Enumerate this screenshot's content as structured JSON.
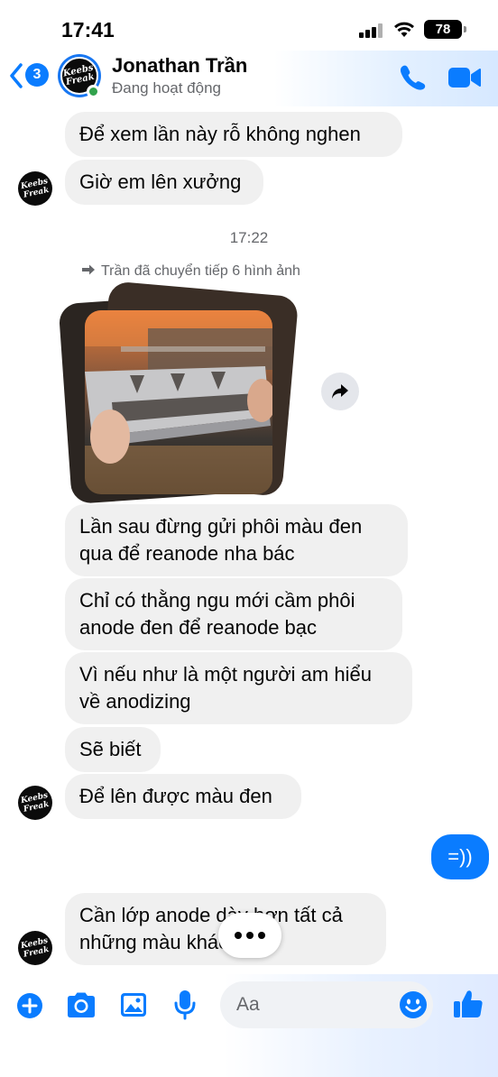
{
  "status_bar": {
    "time": "17:41",
    "battery": "78"
  },
  "header": {
    "back_badge": "3",
    "contact_name": "Jonathan Trần",
    "contact_status": "Đang hoạt động",
    "avatar_logo": [
      "Keebs",
      "Freak"
    ]
  },
  "conversation": {
    "bubbles_top": [
      {
        "text": "Để xem lần này rỗ không nghen"
      },
      {
        "text": "Giờ em lên xưởng"
      }
    ],
    "timestamp": "17:22",
    "forward_note": "Trần đã chuyển tiếp 6 hình ảnh",
    "bubbles_mid": [
      {
        "line1": "Lần sau đừng gửi phôi màu đen",
        "line2": "qua để reanode nha bác"
      },
      {
        "line1": "Chỉ có thằng ngu mới cầm phôi",
        "line2": "anode đen để reanode bạc"
      },
      {
        "line1": "Vì nếu như là một người am hiểu",
        "line2": "về anodizing"
      }
    ],
    "bubble_se_biet": "Sẽ biết",
    "bubble_de_len": "Để lên được màu đen",
    "outgoing": "=))",
    "last_bubble": {
      "line1": "Cần lớp anode dày hơn tất cả",
      "line2": "những màu khác"
    }
  },
  "composer": {
    "placeholder": "Aa"
  },
  "colors": {
    "accent": "#0a7cff",
    "bubble_gray": "#f0f0f0",
    "online": "#31a24c"
  },
  "icons": {
    "add": "plus-circle-icon",
    "camera": "camera-icon",
    "gallery": "image-icon",
    "mic": "microphone-icon",
    "emoji": "smiley-icon",
    "like": "thumbs-up-icon",
    "call": "phone-icon",
    "video": "video-camera-icon",
    "back": "chevron-left-icon",
    "share": "share-arrow-icon",
    "forward": "forward-arrow-icon"
  }
}
